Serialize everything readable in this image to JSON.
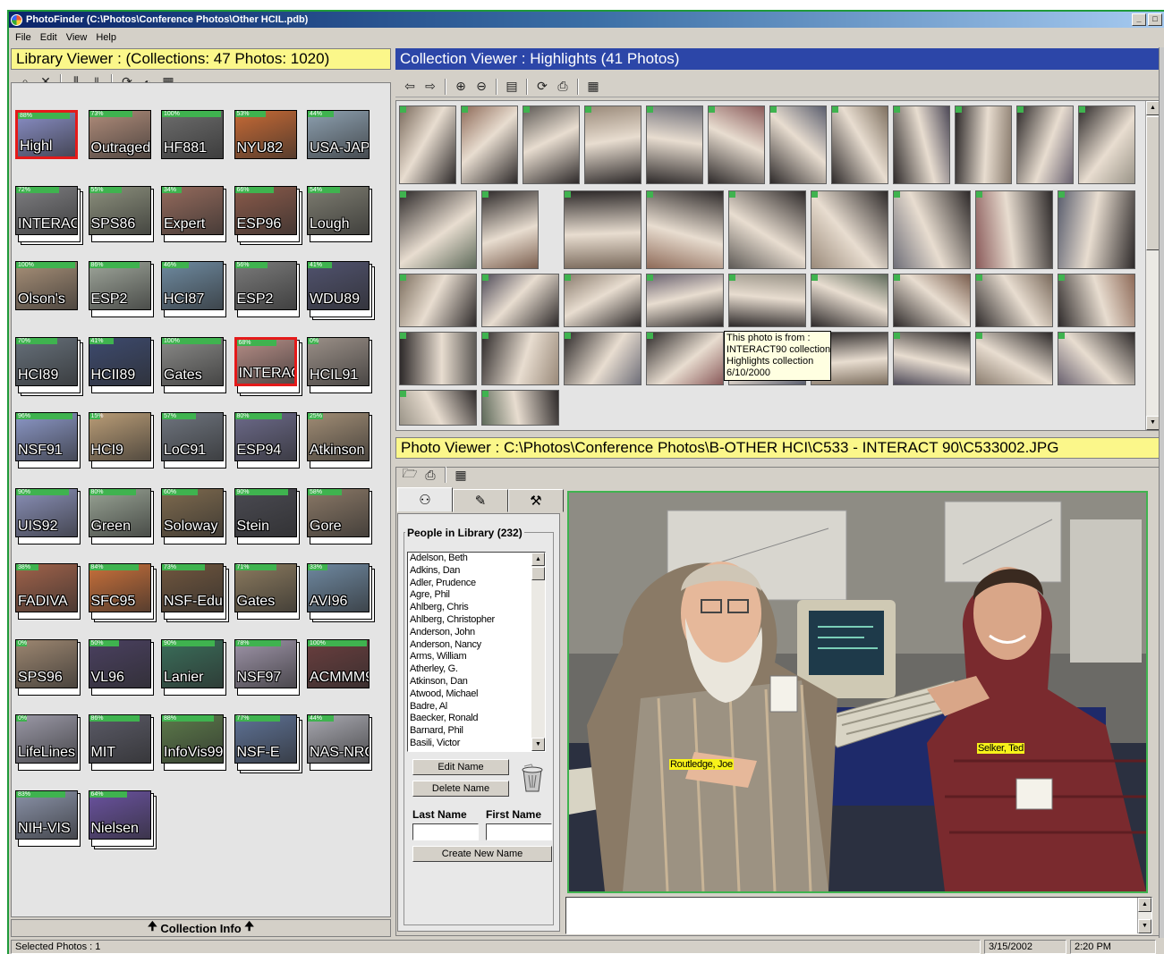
{
  "window": {
    "title": "PhotoFinder (C:\\Photos\\Conference Photos\\Other HCIL.pdb)",
    "minimize": "_",
    "maximize": "□"
  },
  "menu": [
    "File",
    "Edit",
    "View",
    "Help"
  ],
  "library": {
    "header": "Library Viewer : (Collections: 47 Photos: 1020)",
    "collection_info_label": "Collection Info",
    "collections": [
      {
        "name": "Highl",
        "pct": "88%",
        "bg": "#8a8fc7",
        "sel": true,
        "stack": 1
      },
      {
        "name": "Outraged",
        "pct": "73%",
        "bg": "#b08c7a",
        "stack": 1
      },
      {
        "name": "HF881",
        "pct": "100%",
        "bg": "#6d6d6d",
        "stack": 1
      },
      {
        "name": "NYU82",
        "pct": "53%",
        "bg": "#c76a35",
        "stack": 1
      },
      {
        "name": "USA-JAP",
        "pct": "44%",
        "bg": "#8da0b0",
        "stack": 1
      },
      {
        "name": "INTERAC",
        "pct": "72%",
        "bg": "#7d7d80",
        "stack": 3
      },
      {
        "name": "SPS86",
        "pct": "55%",
        "bg": "#8b8f7c",
        "stack": 2
      },
      {
        "name": "Expert",
        "pct": "34%",
        "bg": "#946a5c",
        "stack": 2
      },
      {
        "name": "ESP96",
        "pct": "66%",
        "bg": "#8a5a4a",
        "stack": 3
      },
      {
        "name": "Lough",
        "pct": "54%",
        "bg": "#7d7c70",
        "stack": 2
      },
      {
        "name": "Olson's",
        "pct": "100%",
        "bg": "#a89078",
        "stack": 1
      },
      {
        "name": "ESP2",
        "pct": "86%",
        "bg": "#9ea59a",
        "stack": 2
      },
      {
        "name": "HCI87",
        "pct": "46%",
        "bg": "#6e8aa0",
        "stack": 2
      },
      {
        "name": "ESP2",
        "pct": "56%",
        "bg": "#7a7a7a",
        "stack": 2
      },
      {
        "name": "WDU89",
        "pct": "41%",
        "bg": "#50526e",
        "stack": 3
      },
      {
        "name": "HCI89",
        "pct": "70%",
        "bg": "#66707a",
        "stack": 3
      },
      {
        "name": "HCII89",
        "pct": "41%",
        "bg": "#3d4a6e",
        "stack": 2
      },
      {
        "name": "Gates",
        "pct": "100%",
        "bg": "#8a8a88",
        "stack": 2
      },
      {
        "name": "INTERAC",
        "pct": "68%",
        "bg": "#b58d86",
        "sel": true,
        "stack": 3
      },
      {
        "name": "HCIL91",
        "pct": "0%",
        "bg": "#9a8f87",
        "stack": 2
      },
      {
        "name": "NSF91",
        "pct": "96%",
        "bg": "#8c98c8",
        "stack": 2
      },
      {
        "name": "HCI9",
        "pct": "15%",
        "bg": "#b99c76",
        "stack": 2
      },
      {
        "name": "LoC91",
        "pct": "57%",
        "bg": "#6e747e",
        "stack": 2
      },
      {
        "name": "ESP94",
        "pct": "80%",
        "bg": "#6c6a8a",
        "stack": 2
      },
      {
        "name": "Atkinson",
        "pct": "25%",
        "bg": "#a08c74",
        "stack": 2
      },
      {
        "name": "UIS92",
        "pct": "90%",
        "bg": "#8a90b8",
        "stack": 2
      },
      {
        "name": "Green",
        "pct": "80%",
        "bg": "#98a394",
        "stack": 2
      },
      {
        "name": "Soloway",
        "pct": "60%",
        "bg": "#7e6a4e",
        "stack": 2
      },
      {
        "name": "Stein",
        "pct": "90%",
        "bg": "#4a4a52",
        "stack": 2
      },
      {
        "name": "Gore",
        "pct": "58%",
        "bg": "#8a7866",
        "stack": 2
      },
      {
        "name": "FADIVA",
        "pct": "38%",
        "bg": "#a0624a",
        "stack": 2
      },
      {
        "name": "SFC95",
        "pct": "84%",
        "bg": "#c9703a",
        "stack": 3
      },
      {
        "name": "NSF-Edu",
        "pct": "73%",
        "bg": "#70563e",
        "stack": 3
      },
      {
        "name": "Gates",
        "pct": "71%",
        "bg": "#8b7a5e",
        "stack": 2
      },
      {
        "name": "AVI96",
        "pct": "33%",
        "bg": "#6e88a0",
        "stack": 3
      },
      {
        "name": "SPS96",
        "pct": "0%",
        "bg": "#9c8670",
        "stack": 2
      },
      {
        "name": "VL96",
        "pct": "50%",
        "bg": "#4a4060",
        "stack": 2
      },
      {
        "name": "Lanier",
        "pct": "90%",
        "bg": "#3a6e5a",
        "stack": 2
      },
      {
        "name": "NSF97",
        "pct": "78%",
        "bg": "#9e94a8",
        "stack": 2
      },
      {
        "name": "ACMMM9",
        "pct": "100%",
        "bg": "#6a3e3e",
        "stack": 1
      },
      {
        "name": "LifeLines",
        "pct": "0%",
        "bg": "#9a98a6",
        "stack": 2
      },
      {
        "name": "MIT",
        "pct": "86%",
        "bg": "#5a5a66",
        "stack": 2
      },
      {
        "name": "InfoVis99",
        "pct": "88%",
        "bg": "#5c7a4a",
        "stack": 2
      },
      {
        "name": "NSF-E",
        "pct": "77%",
        "bg": "#5e7296",
        "stack": 3
      },
      {
        "name": "NAS-NRC",
        "pct": "44%",
        "bg": "#a8a8b0",
        "stack": 2
      },
      {
        "name": "NIH-VIS",
        "pct": "83%",
        "bg": "#8a92a8",
        "stack": 2
      },
      {
        "name": "Nielsen",
        "pct": "64%",
        "bg": "#6a52a0",
        "stack": 3
      }
    ]
  },
  "collection_viewer": {
    "header": "Collection Viewer : Highlights (41 Photos)",
    "tooltip": [
      "This photo is from :",
      "INTERACT90 collection",
      "Highlights collection",
      "6/10/2000"
    ]
  },
  "photo_viewer": {
    "header": "Photo Viewer : C:\\Photos\\Conference Photos\\B-OTHER HCI\\C533 - INTERACT 90\\C533002.JPG",
    "people_title": "People in Library (232)",
    "people": [
      "Adelson, Beth",
      "Adkins, Dan",
      "Adler, Prudence",
      "Agre, Phil",
      "Ahlberg, Chris",
      "Ahlberg, Christopher",
      "Anderson, John",
      "Anderson, Nancy",
      "Arms, William",
      "Atherley, G.",
      "Atkinson, Dan",
      "Atwood, Michael",
      "Badre, Al",
      "Baecker, Ronald",
      "Barnard, Phil",
      "Basili, Victor"
    ],
    "edit_name": "Edit Name",
    "delete_name": "Delete Name",
    "last_name_label": "Last Name",
    "first_name_label": "First Name",
    "create_new_name": "Create New Name",
    "last_name_value": "",
    "first_name_value": "",
    "tags": [
      {
        "label": "Routledge, Joe"
      },
      {
        "label": "Selker, Ted"
      }
    ]
  },
  "status": {
    "selected": "Selected Photos : 1",
    "date": "3/15/2002",
    "time": "2:20 PM"
  },
  "colors": {
    "accent_green": "#3fb34f",
    "header_yellow": "#fbf78a",
    "header_blue": "#2c46a8",
    "tag_yellow": "#f7f21a"
  }
}
